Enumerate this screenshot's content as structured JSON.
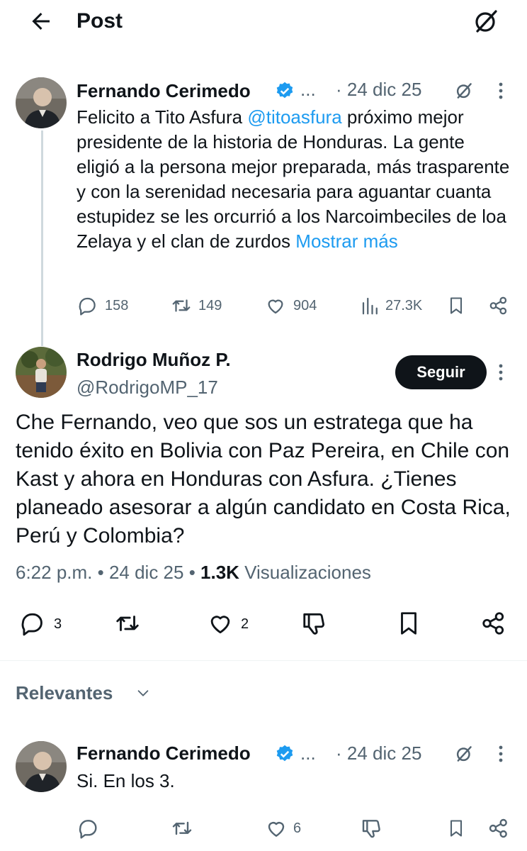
{
  "header": {
    "title": "Post"
  },
  "parent_post": {
    "author_name": "Fernando Cerimedo",
    "author_ellipsis": "...",
    "date": "· 24 dic 25",
    "text_before_mention": "Felicito a Tito Asfura ",
    "mention": "@titoasfura",
    "text_after_mention": " próximo mejor presidente de la historia de Honduras. La gente eligió a la persona mejor preparada, más trasparente y con la serenidad necesaria para aguantar cuanta estupidez se les orcurrió a los Narcoimbeciles de loa Zelaya y el clan de zurdos ",
    "show_more": "Mostrar más",
    "replies": "158",
    "reposts": "149",
    "likes": "904",
    "views": "27.3K"
  },
  "main_post": {
    "author_name": "Rodrigo Muñoz P.",
    "handle": "@RodrigoMP_17",
    "follow_label": "Seguir",
    "text": "Che Fernando, veo que sos un estratega que ha tenido éxito en Bolivia con Paz Pereira, en Chile con Kast y ahora en Honduras con Asfura. ¿Tienes planeado asesorar a algún candidato en Costa Rica, Perú y Colombia?",
    "time": "6:22 p.m. • 24 dic 25 • ",
    "views_count": "1.3K",
    "views_label": " Visualizaciones",
    "replies": "3",
    "likes": "2"
  },
  "sort": {
    "label": "Relevantes"
  },
  "reply_post": {
    "author_name": "Fernando Cerimedo",
    "author_ellipsis": "...",
    "date": "· 24 dic 25",
    "text": "Si. En los 3.",
    "likes": "6"
  },
  "colors": {
    "accent": "#1d9bf0",
    "text": "#0f1419",
    "muted": "#536471"
  },
  "icons": [
    "back-arrow-icon",
    "grok-icon",
    "verified-badge-icon",
    "more-icon",
    "reply-icon",
    "repost-icon",
    "like-icon",
    "views-icon",
    "bookmark-icon",
    "share-icon",
    "dislike-icon",
    "chevron-down-icon"
  ]
}
